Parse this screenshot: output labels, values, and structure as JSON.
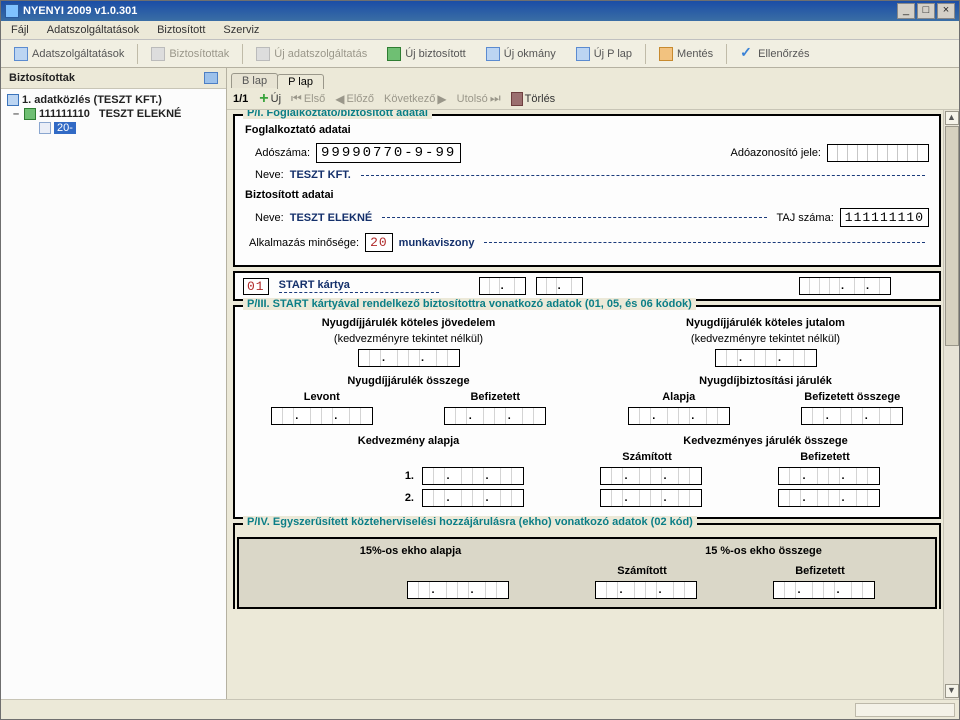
{
  "window": {
    "title": "NYENYI 2009  v1.0.301"
  },
  "menu": {
    "file": "Fájl",
    "adat": "Adatszolgáltatások",
    "bizt": "Biztosított",
    "szerviz": "Szerviz"
  },
  "toolbar": {
    "adat": "Adatszolgáltatások",
    "biztList": "Biztosítottak",
    "ujAdat": "Új adatszolgáltatás",
    "ujBizt": "Új biztosított",
    "ujOkm": "Új okmány",
    "ujPlap": "Új P lap",
    "mentes": "Mentés",
    "ellen": "Ellenőrzés"
  },
  "sidebar": {
    "header": "Biztosítottak",
    "node1": "1. adatközlés (TESZT KFT.)",
    "node2a": "111111110",
    "node2b": "TESZT ELEKNÉ",
    "node3": "20-"
  },
  "tabs": {
    "blap": "B lap",
    "plap": "P lap"
  },
  "pager": {
    "count": "1/1",
    "uj": "Új",
    "elso": "Első",
    "elozo": "Előző",
    "kov": "Következő",
    "utolso": "Utolsó",
    "torles": "Törlés"
  },
  "p1": {
    "legend": "P/I. Foglalkoztató/biztosított adatai",
    "fogHdr": "Foglalkoztató adatai",
    "adoszamLbl": "Adószáma:",
    "adoszam": "99990770-9-99",
    "adoazLbl": "Adóazonosító jele:",
    "nevLbl": "Neve:",
    "fogNev": "TESZT KFT.",
    "biztHdr": "Biztosított adatai",
    "biztNev": "TESZT ELEKNÉ",
    "tajLbl": "TAJ száma:",
    "taj": "111111110",
    "alkMinLbl": "Alkalmazás minősége:",
    "alkMinKod": "20",
    "alkMinTxt": "munkaviszony"
  },
  "p2": {
    "code": "01",
    "label": "START kártya"
  },
  "p3": {
    "legend": "P/III. START kártyával rendelkező biztosítottra vonatkozó adatok (01, 05, és 06 kódok)",
    "nyjkj": "Nyugdíjjárulék köteles jövedelem",
    "kedv": "(kedvezményre tekintet nélkül)",
    "nyjkjut": "Nyugdíjjárulék köteles jutalom",
    "nyjossz": "Nyugdíjjárulék összege",
    "nybiztj": "Nyugdíjbiztosítási járulék",
    "levont": "Levont",
    "befiz": "Befizetett",
    "alapja": "Alapja",
    "befossz": "Befizetett összege",
    "kedvalap": "Kedvezmény alapja",
    "kedvjar": "Kedvezményes járulék összege",
    "szam": "Számított",
    "row1": "1.",
    "row2": "2."
  },
  "p4": {
    "legend": "P/IV. Egyszerűsített közteherviselési hozzájárulásra (ekho) vonatkozó adatok (02 kód)",
    "alap": "15%-os ekho alapja",
    "ossz": "15 %-os ekho összege",
    "szam": "Számított",
    "befiz": "Befizetett"
  }
}
